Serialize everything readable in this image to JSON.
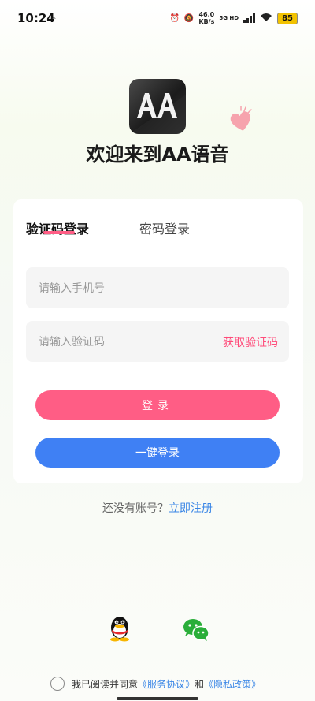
{
  "status_bar": {
    "time": "10:24",
    "download_icon": "download-arrow-icon",
    "speed_value": "46.0",
    "speed_unit": "KB/s",
    "network": "5G HD",
    "battery": "85"
  },
  "header": {
    "logo_icon": "aa-app-logo",
    "logo_text": "AA",
    "title": "欢迎来到AA语音"
  },
  "login_card": {
    "tabs": [
      {
        "label": "验证码登录",
        "active": true
      },
      {
        "label": "密码登录",
        "active": false
      }
    ],
    "phone_placeholder": "请输入手机号",
    "code_placeholder": "请输入验证码",
    "get_code_label": "获取验证码",
    "login_button": "登录",
    "one_key_button": "一键登录"
  },
  "register": {
    "prompt": "还没有账号？",
    "link": "立即注册"
  },
  "third_party": [
    {
      "name": "qq-icon"
    },
    {
      "name": "wechat-icon"
    }
  ],
  "agreement": {
    "prefix": "我已阅读并同意",
    "service": "《服务协议》",
    "and": "和",
    "privacy": "《隐私政策》"
  },
  "colors": {
    "accent_pink": "#ff5d85",
    "accent_blue": "#3f80f4",
    "link_blue": "#3a86e6"
  }
}
